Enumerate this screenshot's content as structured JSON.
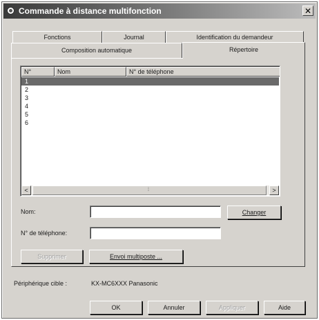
{
  "window": {
    "title": "Commande à distance multifonction",
    "close_glyph": "✕"
  },
  "tabs": {
    "row1": [
      "Fonctions",
      "Journal",
      "Identification du demandeur"
    ],
    "row2": [
      "Composition automatique",
      "Répertoire"
    ],
    "active": "Répertoire"
  },
  "list": {
    "columns": [
      "N°",
      "Nom",
      "N° de téléphone"
    ],
    "rows": [
      "1",
      "2",
      "3",
      "4",
      "5",
      "6"
    ],
    "selected_row": "1",
    "scroll_left": "<",
    "scroll_right": ">"
  },
  "form": {
    "name_label": "Nom:",
    "name_value": "",
    "phone_label": "N° de téléphone:",
    "phone_value": "",
    "change_button": "Changer",
    "delete_button": "Supprimer",
    "multipost_button": "Envoi multiposte ..."
  },
  "device": {
    "label": "Périphérique cible :",
    "value": "KX-MC6XXX Panasonic"
  },
  "footer": {
    "ok_button": "OK",
    "cancel_button": "Annuler",
    "apply_button": "Appliquer",
    "help_button": "Aide"
  },
  "colors": {
    "window_bg": "#d6d3ce",
    "titlebar_dark": "#3a3a3a",
    "selected_row": "#6a6a6a"
  }
}
